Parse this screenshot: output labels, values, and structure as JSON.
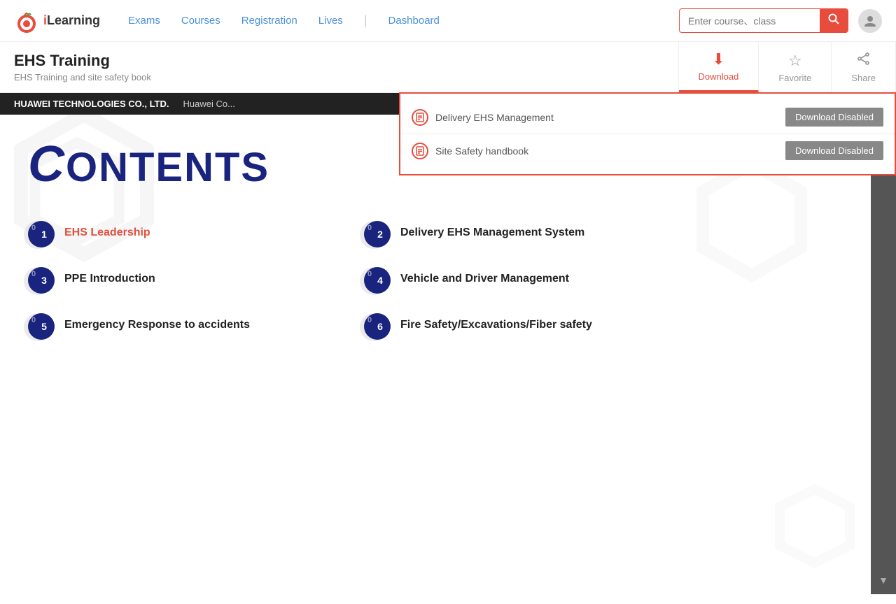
{
  "header": {
    "logo_text_i": "i",
    "logo_text_rest": "Learning",
    "nav": [
      {
        "label": "Exams",
        "href": "#"
      },
      {
        "label": "Courses",
        "href": "#"
      },
      {
        "label": "Registration",
        "href": "#"
      },
      {
        "label": "Lives",
        "href": "#"
      },
      {
        "label": "Dashboard",
        "href": "#"
      }
    ],
    "search_placeholder": "Enter course、class",
    "search_icon": "🔍"
  },
  "course_header": {
    "title": "EHS Training",
    "subtitle": "EHS Training and site safety book",
    "actions": [
      {
        "label": "Download",
        "icon": "⬇",
        "active": true
      },
      {
        "label": "Favorite",
        "icon": "☆",
        "active": false
      },
      {
        "label": "Share",
        "icon": "↗",
        "active": false
      }
    ]
  },
  "download_dropdown": {
    "items": [
      {
        "name": "Delivery EHS Management",
        "button_label": "Download Disabled"
      },
      {
        "name": "Site Safety handbook",
        "button_label": "Download Disabled"
      }
    ]
  },
  "black_bar": {
    "company": "HUAWEI TECHNOLOGIES CO., LTD.",
    "name": "Huawei Co..."
  },
  "book_page": {
    "contents_title_c": "C",
    "contents_title_rest": "ontents",
    "items": [
      {
        "number": "01",
        "label": "EHS Leadership",
        "red": true
      },
      {
        "number": "02",
        "label": "Delivery EHS Management System",
        "red": false
      },
      {
        "number": "03",
        "label": "PPE Introduction",
        "red": false
      },
      {
        "number": "04",
        "label": "Vehicle and Driver Management",
        "red": false
      },
      {
        "number": "05",
        "label": "Emergency Response to accidents",
        "red": false
      },
      {
        "number": "06",
        "label": "Fire Safety/Excavations/Fiber safety",
        "red": false
      }
    ]
  },
  "sidebar": {
    "icons": [
      "pdf",
      "pdf2"
    ]
  }
}
